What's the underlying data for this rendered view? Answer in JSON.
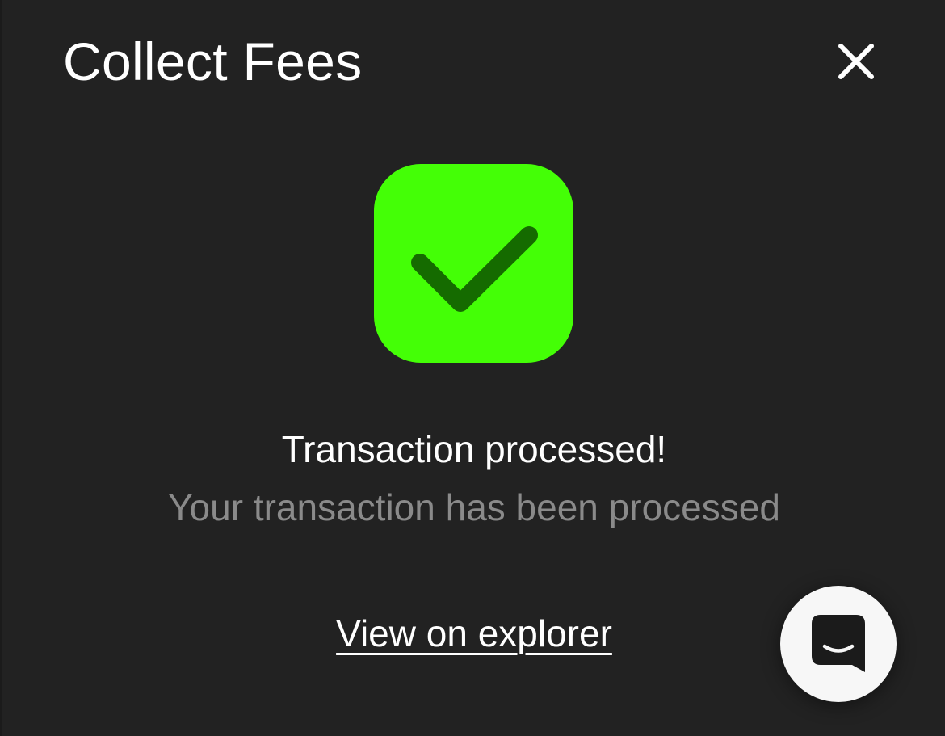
{
  "modal": {
    "title": "Collect Fees",
    "close_icon": "close-icon"
  },
  "status": {
    "icon": "check-icon",
    "badge_color": "#44ff06",
    "check_color": "#156b00",
    "headline": "Transaction processed!",
    "message": "Your transaction has been processed"
  },
  "actions": {
    "explorer_link": "View on explorer"
  },
  "chat": {
    "icon": "chat-icon"
  }
}
